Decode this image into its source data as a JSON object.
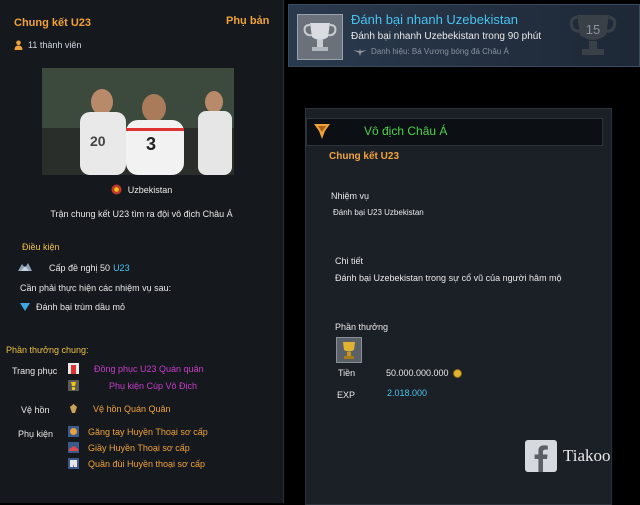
{
  "left": {
    "title": "Chung kết U23",
    "tag": "Phụ bản",
    "members": "11 thành viên",
    "opponent": "Uzbekistan",
    "description": "Trận chung kết U23 tìm ra đội vô địch Châu Á",
    "conditions_label": "Điều kiện",
    "level_label": "Cấp đề nghị 50",
    "level_value": "U23",
    "mission_prompt": "Cần phải thực hiện các nhiệm vụ sau:",
    "mission_item": "Đánh bại trùm dầu mỏ",
    "rewards_label": "Phần thưởng chung:",
    "rewards": [
      {
        "category": "Trang phục",
        "items": [
          {
            "name": "Đồng phục U23 Quán quân",
            "color": "#c63ec8",
            "icon": "jersey-icon"
          },
          {
            "name": "Phụ kiện Cúp Vô Địch",
            "color": "#c63ec8",
            "icon": "cup-accessory-icon"
          }
        ]
      },
      {
        "category": "Vệ hồn",
        "items": [
          {
            "name": "Vệ hồn Quán Quân",
            "color": "#f0a23a",
            "icon": "guardian-icon"
          }
        ]
      },
      {
        "category": "Phụ kiện",
        "items": [
          {
            "name": "Găng tay Huyền Thoại sơ cấp",
            "color": "#f0a23a",
            "icon": "glove-icon"
          },
          {
            "name": "Giầy Huyền Thoại sơ cấp",
            "color": "#f0a23a",
            "icon": "shoe-icon"
          },
          {
            "name": "Quần đùi Huyền thoại sơ cấp",
            "color": "#f0a23a",
            "icon": "shorts-icon"
          }
        ]
      }
    ]
  },
  "banner": {
    "title": "Đánh bại nhanh Uzebekistan",
    "subtitle": "Đánh bại nhanh Uzebekistan trong 90 phút",
    "honor": "Danh hiệu: Bá Vương bóng đá Châu Á",
    "badge_number": "15"
  },
  "panel": {
    "header": "Vô địch Châu Á",
    "subheader": "Chung kết U23",
    "mission_label": "Nhiệm vụ",
    "mission_value": "Đánh bại U23 Uzbekistan",
    "detail_label": "Chi tiết",
    "detail_value": "Đánh bại Uzebekistan trong sự cổ vũ của người hâm mộ",
    "reward_label": "Phần thưởng",
    "money_label": "Tiền",
    "money_value": "50.000.000.000",
    "exp_label": "EXP",
    "exp_value": "2.018.000"
  },
  "watermark": "Tiakoo",
  "colors": {
    "orange": "#f0a23a",
    "yellow": "#f0c040",
    "cyan": "#49c3f0",
    "purple": "#c63ec8",
    "green": "#4ed24e"
  }
}
